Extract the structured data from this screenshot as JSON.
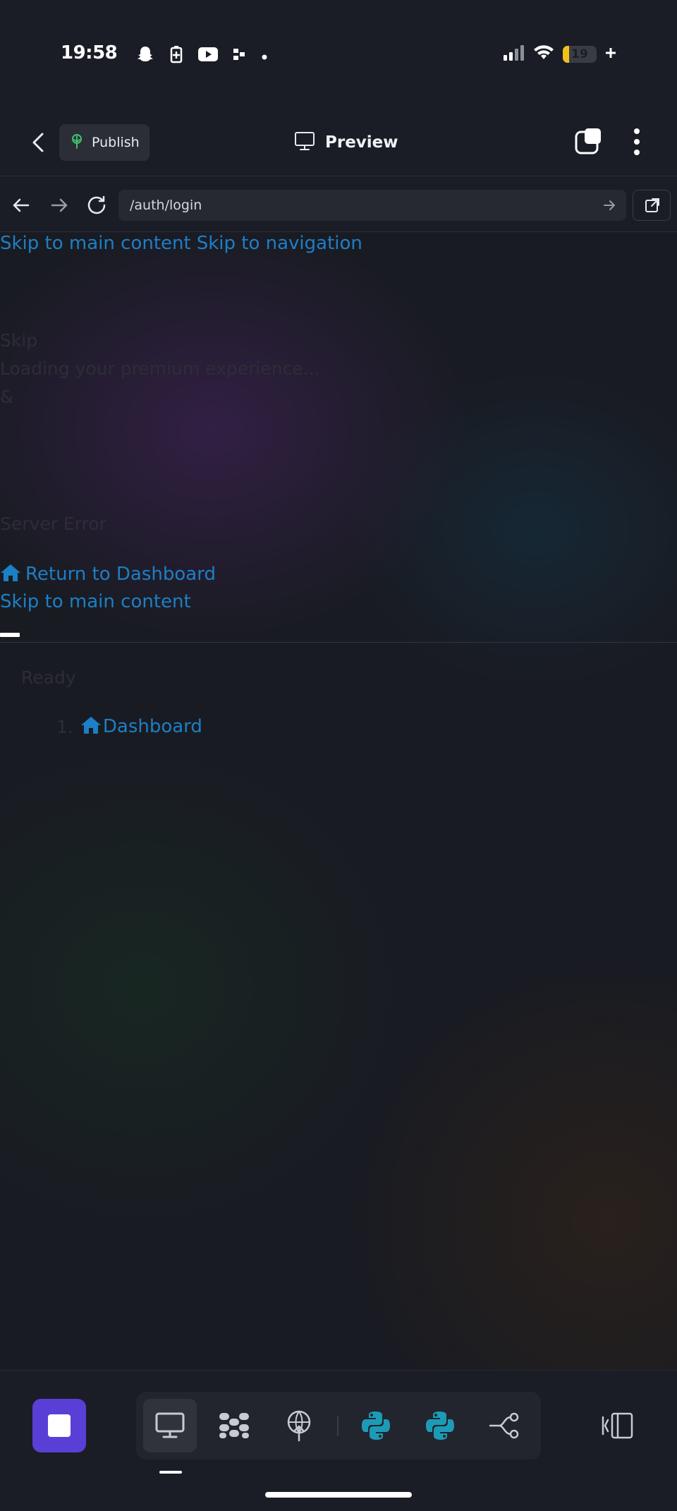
{
  "status_bar": {
    "time": "19:58",
    "battery_level": "19",
    "icons": [
      "snapchat-icon",
      "battery-saver-icon",
      "youtube-icon",
      "tiktok-icon",
      "dot-icon",
      "signal-icon",
      "wifi-icon",
      "battery-icon"
    ]
  },
  "header": {
    "publish_label": "Publish",
    "title": "Preview"
  },
  "url_bar": {
    "url": "/auth/login"
  },
  "page": {
    "skip_main": "Skip to main content",
    "skip_nav": "Skip to navigation",
    "loading_line1": "Skip",
    "loading_line2": "Loading your premium experience...",
    "loading_line3": "&",
    "error_text": "Server Error",
    "return_link": "Return to Dashboard",
    "skip_main_2": "Skip to main content",
    "status_text": "Ready",
    "breadcrumb_number": "1.",
    "breadcrumb_link": "Dashboard"
  },
  "colors": {
    "link": "#1d7fc5",
    "accent": "#5a3fd6",
    "python": "#1c9bb8"
  }
}
